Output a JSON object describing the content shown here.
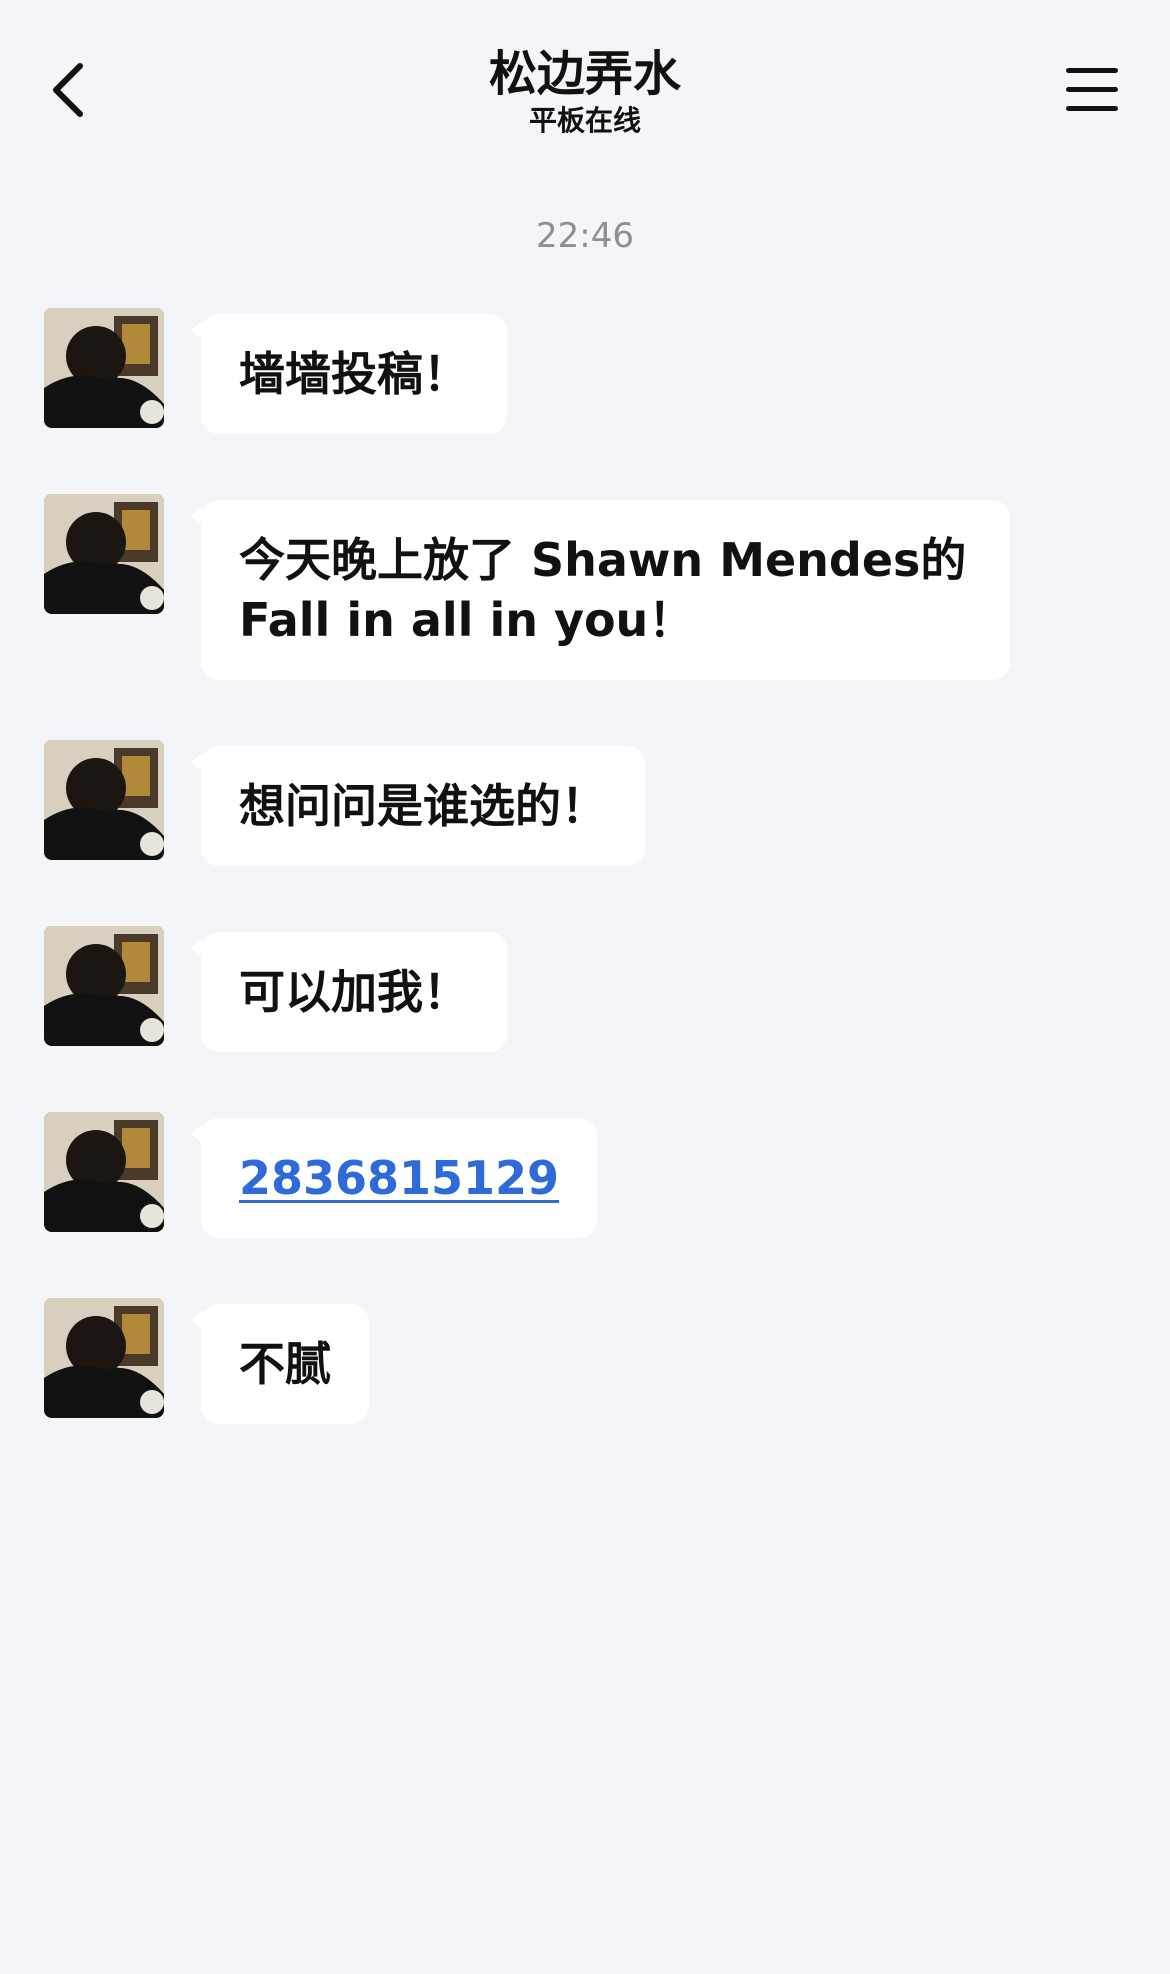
{
  "header": {
    "title": "松边弄水",
    "status": "平板在线",
    "back_icon": "chevron-left-icon",
    "menu_icon": "hamburger-menu-icon"
  },
  "chat": {
    "timestamp": "22:46",
    "messages": [
      {
        "lines": [
          "墙墙投稿！"
        ],
        "type": "text"
      },
      {
        "lines": [
          "今天晚上放了 Shawn Mendes的",
          "Fall in all in you！"
        ],
        "type": "text"
      },
      {
        "lines": [
          "想问问是谁选的！"
        ],
        "type": "text"
      },
      {
        "lines": [
          "可以加我！"
        ],
        "type": "text"
      },
      {
        "lines": [
          "2836815129"
        ],
        "type": "link"
      },
      {
        "lines": [
          "不腻"
        ],
        "type": "text"
      }
    ]
  },
  "colors": {
    "background": "#f4f5f9",
    "bubble": "#ffffff",
    "link": "#2f6bd8",
    "timestamp": "#8e8e93"
  }
}
